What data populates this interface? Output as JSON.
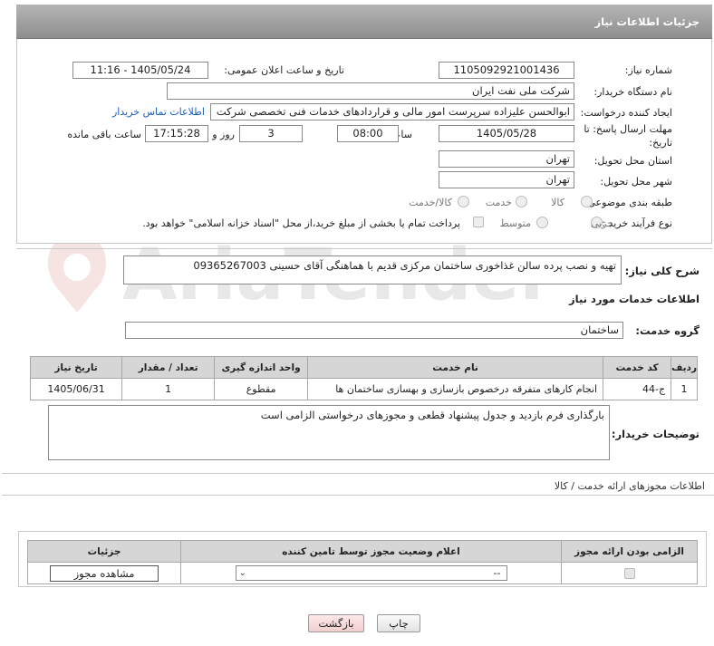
{
  "header": {
    "title": "جزئیات اطلاعات نیاز"
  },
  "fields": {
    "need_number_label": "شماره نیاز:",
    "need_number": "1105092921001436",
    "announce_label": "تاریخ و ساعت اعلان عمومی:",
    "announce_value": "1405/05/24 - 11:16",
    "buyer_org_label": "نام دستگاه خریدار:",
    "buyer_org": "شرکت ملی نفت ایران",
    "creator_label": "ایجاد کننده درخواست:",
    "creator": "ابوالحسن علیزاده سرپرست امور مالی و قراردادهای خدمات فنی تخصصی شرکت",
    "contact_link": "اطلاعات تماس خریدار",
    "deadline_label_1": "مهلت ارسال پاسخ: تا",
    "deadline_label_2": "تاریخ:",
    "deadline_date": "1405/05/28",
    "time_label": "ساعت",
    "deadline_time": "08:00",
    "days_value": "3",
    "days_label": "روز و",
    "remaining_time": "17:15:28",
    "remaining_label": "ساعت باقی مانده",
    "province_label": "استان محل تحویل:",
    "province": "تهران",
    "city_label": "شهر محل تحویل:",
    "city": "تهران",
    "category_label": "طبقه بندی موضوعی:",
    "category_options": [
      "کالا",
      "خدمت",
      "کالا/خدمت"
    ],
    "process_label": "نوع فرآیند خرید :",
    "process_options": [
      "جزیی",
      "متوسط"
    ],
    "payment_note": "پرداخت تمام یا بخشی از مبلغ خرید،از محل \"اسناد خزانه اسلامی\" خواهد بود."
  },
  "summary": {
    "label": "شرح کلی نیاز:",
    "text": "تهیه و نصب پرده سالن غذاخوری ساختمان مرکزی قدیم با هماهنگی آقای حسینی 09365267003"
  },
  "services": {
    "section_title": "اطلاعات خدمات مورد نیاز",
    "group_label": "گروه خدمت:",
    "group_value": "ساختمان",
    "columns": [
      "ردیف",
      "کد خدمت",
      "نام خدمت",
      "واحد اندازه گیری",
      "تعداد / مقدار",
      "تاریخ نیاز"
    ],
    "rows": [
      [
        "1",
        "ج-44",
        "انجام کارهای متفرقه درخصوص بازسازی و بهسازی ساختمان ها",
        "مقطوع",
        "1",
        "1405/06/31"
      ]
    ]
  },
  "buyer_notes": {
    "label": "توضیحات خریدار:",
    "text": "بارگذاری فرم بازدید و جدول پیشنهاد قطعی و مجوزهای درخواستی الزامی است"
  },
  "permits": {
    "title": "اطلاعات مجوزهای ارائه خدمت / کالا",
    "columns": [
      "الزامی بودن ارائه مجوز",
      "اعلام وضعیت مجوز توسط تامین کننده",
      "جزئیات"
    ],
    "select_value": "--",
    "view_button": "مشاهده مجوز"
  },
  "actions": {
    "print": "چاپ",
    "back": "بازگشت"
  },
  "watermark": {
    "text": "AriaTender.net"
  },
  "colors": {
    "header": "#9f9f9f",
    "link": "#1a5fb4",
    "back_button": "#f6d6d6",
    "watermark": "#c0392b"
  }
}
